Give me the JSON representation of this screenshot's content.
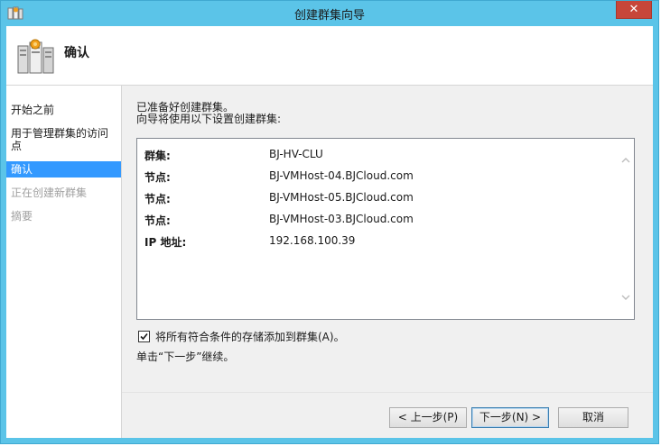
{
  "window": {
    "title": "创建群集向导",
    "close_glyph": "✕"
  },
  "header": {
    "title": "确认",
    "icon": "cluster-servers-icon"
  },
  "sidebar": {
    "items": [
      {
        "label": "开始之前",
        "state": "normal"
      },
      {
        "label": "用于管理群集的访问点",
        "state": "normal"
      },
      {
        "label": "确认",
        "state": "active"
      },
      {
        "label": "正在创建新群集",
        "state": "disabled"
      },
      {
        "label": "摘要",
        "state": "disabled"
      }
    ]
  },
  "main": {
    "intro_line1": "已准备好创建群集。",
    "intro_line2": "向导将使用以下设置创建群集:",
    "summary": [
      {
        "label": "群集:",
        "value": "BJ-HV-CLU"
      },
      {
        "label": "节点:",
        "value": "BJ-VMHost-04.BJCloud.com"
      },
      {
        "label": "节点:",
        "value": "BJ-VMHost-05.BJCloud.com"
      },
      {
        "label": "节点:",
        "value": "BJ-VMHost-03.BJCloud.com"
      },
      {
        "label": "IP 地址:",
        "value": "192.168.100.39"
      }
    ],
    "checkbox_label": "将所有符合条件的存储添加到群集(A)。",
    "checkbox_checked": true,
    "continue_text": "单击“下一步”继续。"
  },
  "buttons": {
    "prev": "< 上一步(P)",
    "next": "下一步(N) >",
    "cancel": "取消"
  },
  "colors": {
    "titlebar": "#5bc4e8",
    "selection": "#3399ff",
    "close": "#c7463a"
  }
}
